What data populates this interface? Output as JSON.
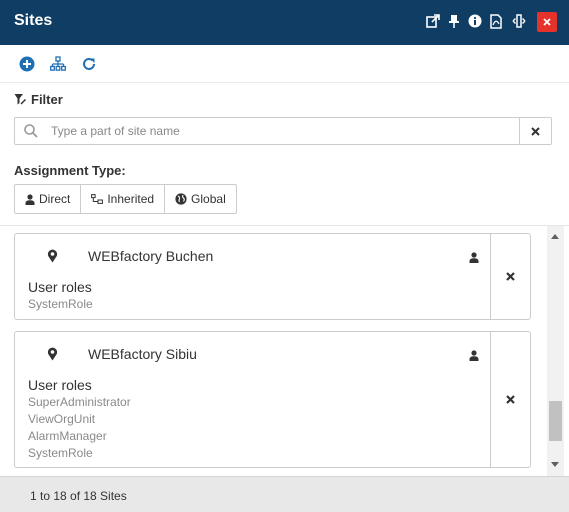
{
  "header": {
    "title": "Sites",
    "icons": [
      "popout-icon",
      "pin-icon",
      "info-icon",
      "pdf-icon",
      "resize-icon",
      "close-icon"
    ],
    "close_color": "#e5322b",
    "background": "#0f3d63"
  },
  "toolbar": {
    "icons": [
      "add-icon",
      "hierarchy-icon",
      "refresh-icon"
    ],
    "accent": "#1f6fb5"
  },
  "filter": {
    "label": "Filter",
    "search_placeholder": "Type a part of site name",
    "search_value": ""
  },
  "assignment": {
    "label": "Assignment Type:",
    "buttons": [
      {
        "label": "Direct",
        "icon": "person-icon"
      },
      {
        "label": "Inherited",
        "icon": "hierarchy-icon"
      },
      {
        "label": "Global",
        "icon": "globe-icon"
      }
    ]
  },
  "sites": [
    {
      "name": "WEBfactory Buchen",
      "roles_title": "User roles",
      "roles": [
        "SystemRole"
      ]
    },
    {
      "name": "WEBfactory Sibiu",
      "roles_title": "User roles",
      "roles": [
        "SuperAdministrator",
        "ViewOrgUnit",
        "AlarmManager",
        "SystemRole"
      ]
    }
  ],
  "footer": {
    "count_text": "1 to 18 of 18 Sites"
  }
}
